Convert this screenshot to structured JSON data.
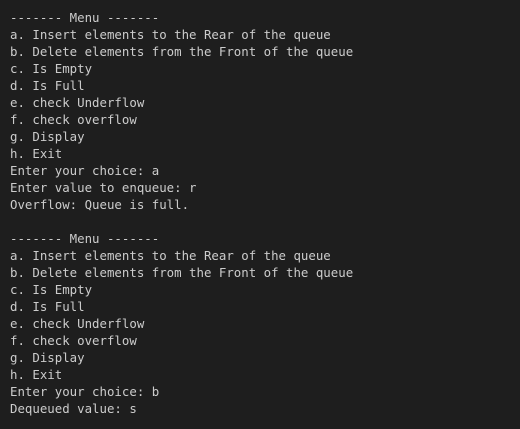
{
  "terminal": {
    "lines": [
      "------- Menu -------",
      "a. Insert elements to the Rear of the queue",
      "b. Delete elements from the Front of the queue",
      "c. Is Empty",
      "d. Is Full",
      "e. check Underflow",
      "f. check overflow",
      "g. Display",
      "h. Exit",
      "Enter your choice: a",
      "Enter value to enqueue: r",
      "Overflow: Queue is full.",
      "",
      "------- Menu -------",
      "a. Insert elements to the Rear of the queue",
      "b. Delete elements from the Front of the queue",
      "c. Is Empty",
      "d. Is Full",
      "e. check Underflow",
      "f. check overflow",
      "g. Display",
      "h. Exit",
      "Enter your choice: b",
      "Dequeued value: s"
    ]
  }
}
